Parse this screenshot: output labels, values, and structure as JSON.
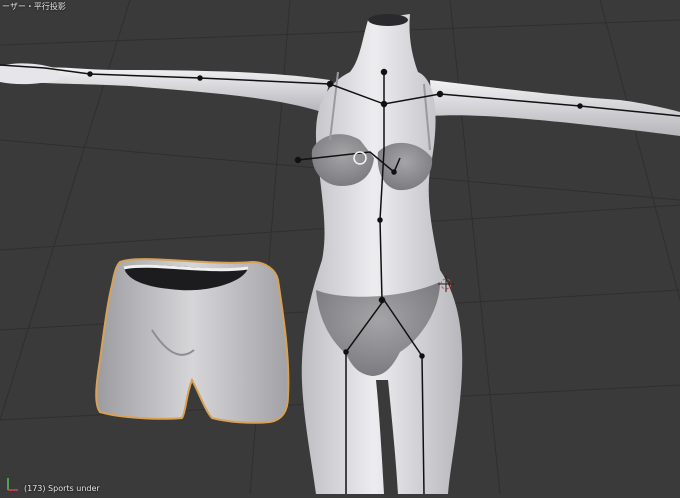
{
  "viewport": {
    "view_title": "ーザー・平行投影",
    "object_info": "(173) Sports under",
    "background_color": "#3a3a3a",
    "grid_color": "#2e2e2e",
    "selection_outline_color": "#d7a256",
    "armature_color": "#111111",
    "mesh_body_color": "#dcdcdf",
    "mesh_underwear_color": "#9b9b9b"
  }
}
